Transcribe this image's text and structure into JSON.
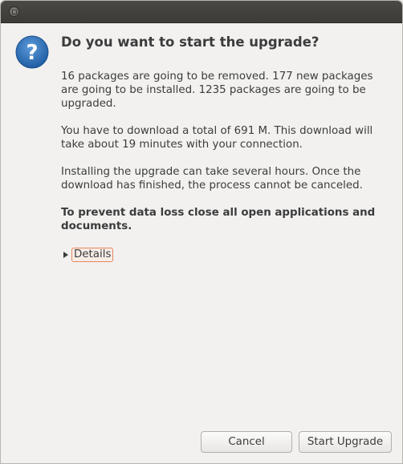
{
  "dialog": {
    "heading": "Do you want to start the upgrade?",
    "paragraphs": [
      "16 packages are going to be removed. 177 new packages are going to be installed. 1235 packages are going to be upgraded.",
      "You have to download a total of 691 M. This download will take about 19 minutes with your connection.",
      "Installing the upgrade can take several hours. Once the download has finished, the process cannot be canceled.",
      "To prevent data loss close all open applications and documents."
    ],
    "details_label": "Details",
    "icon": "question-icon"
  },
  "buttons": {
    "cancel": "Cancel",
    "start": "Start Upgrade"
  },
  "colors": {
    "titlebar": "#3c3b37",
    "background": "#f2f1f0",
    "icon_blue": "#2a6bb3",
    "focus_ring": "#e8845c"
  }
}
